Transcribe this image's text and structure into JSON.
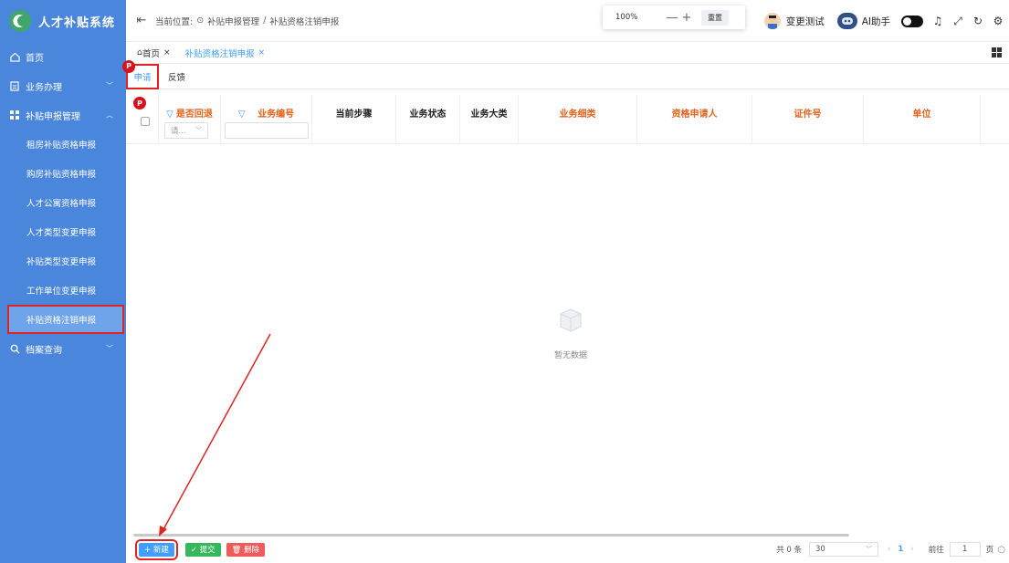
{
  "app": {
    "title": "人才补贴系统",
    "brand_color": "#4a86dc"
  },
  "sidebar": {
    "items": [
      {
        "icon": "home-icon",
        "label": "首页"
      },
      {
        "icon": "calendar-icon",
        "label": "业务办理"
      },
      {
        "icon": "grid-icon",
        "label": "补贴申报管理"
      }
    ],
    "sub_items": [
      "租房补贴资格申报",
      "购房补贴资格申报",
      "人才公寓资格申报",
      "人才类型变更申报",
      "补贴类型变更申报",
      "工作单位变更申报",
      "补贴资格注销申报"
    ],
    "archive": {
      "icon": "search-icon",
      "label": "档案查询"
    },
    "active_sub": "补贴资格注销申报"
  },
  "topbar": {
    "breadcrumb_prefix": "当前位置:",
    "breadcrumb_1": "补贴申报管理",
    "breadcrumb_sep": "/",
    "breadcrumb_2": "补贴资格注销申报",
    "zoom": "100%",
    "zoom_minus": "—",
    "zoom_plus": "+",
    "reset": "重置",
    "user": "变更测试",
    "ai": "AI助手"
  },
  "tabs": {
    "home": "首页",
    "current": "补贴资格注销申报",
    "close": "×"
  },
  "subtabs": {
    "apply": "申请",
    "feedback": "反馈",
    "pin": "P"
  },
  "table": {
    "col_return": "是否回退",
    "col_bizno": "业务编号",
    "col_step": "当前步骤",
    "col_status": "业务状态",
    "col_major": "业务大类",
    "col_minor": "业务细类",
    "col_applicant": "资格申请人",
    "col_idno": "证件号",
    "col_unit": "单位",
    "select_placeholder": "请...",
    "empty": "暂无数据",
    "header_accent": "#e3621b"
  },
  "footer": {
    "add": "+ 新建",
    "submit": "✓ 提交",
    "delete": "🗑 删除",
    "total": "共 0 条",
    "page_size": "30",
    "current_page": "1",
    "goto": "前往",
    "goto_value": "1",
    "page_unit": "页"
  }
}
